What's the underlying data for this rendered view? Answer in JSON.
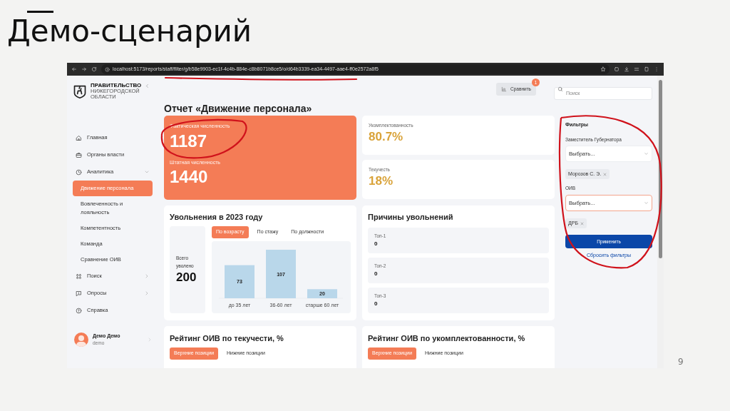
{
  "slide": {
    "title": "Демо-сценарий",
    "page_number": "9"
  },
  "browser": {
    "url": "localhost:5173/reports/staff/filter/g/b58e9903-ec1f-4c4b-884e-c8b8071b8ce5/o/d64b3339-ea34-4497-aae4-ff0e2572a8f5"
  },
  "sidebar": {
    "logo": [
      "ПРАВИТЕЛЬСТВО",
      "НИЖЕГОРОДСКОЙ",
      "ОБЛАСТИ"
    ],
    "items": [
      {
        "label": "Главная"
      },
      {
        "label": "Органы власти"
      },
      {
        "label": "Аналитика",
        "expanded": true,
        "children": [
          {
            "label": "Движение персонала",
            "selected": true
          },
          {
            "label": "Вовлеченность и лояльность",
            "selected": false
          },
          {
            "label": "Компетентность",
            "selected": false
          },
          {
            "label": "Команда",
            "selected": false
          },
          {
            "label": "Сравнение ОИВ",
            "selected": false
          }
        ]
      },
      {
        "label": "Поиск",
        "expanded": false
      },
      {
        "label": "Опросы",
        "expanded": false
      },
      {
        "label": "Справка"
      }
    ],
    "user": {
      "name": "Демо Демо",
      "login": "demo"
    }
  },
  "header": {
    "compare": {
      "label": "Сравнить",
      "badge": "1"
    },
    "search": {
      "placeholder": "Поиск"
    }
  },
  "report": {
    "title": "Отчет «Движение персонала»",
    "headcount": [
      {
        "label": "Фактическая численность",
        "value": "1187"
      },
      {
        "label": "Штатная численность",
        "value": "1440"
      }
    ],
    "rates": [
      {
        "label": "Укомплектованность",
        "value": "80.7%"
      },
      {
        "label": "Текучесть",
        "value": "18%"
      }
    ],
    "dismissals": {
      "title": "Увольнения в 2023 году",
      "total_label": "Всего уволено",
      "total": "200",
      "tabs": [
        {
          "label": "По возрасту",
          "selected": true
        },
        {
          "label": "По стажу",
          "selected": false
        },
        {
          "label": "По должности",
          "selected": false
        }
      ],
      "chart_data": {
        "type": "bar",
        "categories": [
          "до 35 лет",
          "36-60 лет",
          "старше 60 лет"
        ],
        "values": [
          73,
          107,
          20
        ],
        "data_labels": true
      }
    },
    "reasons": {
      "title": "Причины увольнений",
      "items": [
        {
          "label": "Топ-1",
          "value": "0"
        },
        {
          "label": "Топ-2",
          "value": "0"
        },
        {
          "label": "Топ-3",
          "value": "0"
        }
      ]
    },
    "ratings": [
      {
        "title": "Рейтинг ОИВ по текучести, %",
        "tabs": [
          {
            "label": "Верхние позиции",
            "selected": true
          },
          {
            "label": "Нижние позиции",
            "selected": false
          }
        ]
      },
      {
        "title": "Рейтинг ОИВ по укомплектованности, %",
        "tabs": [
          {
            "label": "Верхние позиции",
            "selected": true
          },
          {
            "label": "Нижние позиции",
            "selected": false
          }
        ]
      }
    ]
  },
  "filters": {
    "title": "Фильтры",
    "groups": [
      {
        "label": "Заместитель Губернатора",
        "placeholder": "Выбрать...",
        "focused": false,
        "chips": [
          "Морозов С. Э."
        ]
      },
      {
        "label": "ОИВ",
        "placeholder": "Выбрать...",
        "focused": true,
        "chips": [
          "ДРБ"
        ]
      }
    ],
    "apply": "Применить",
    "reset": "Сбросить фильтры"
  }
}
